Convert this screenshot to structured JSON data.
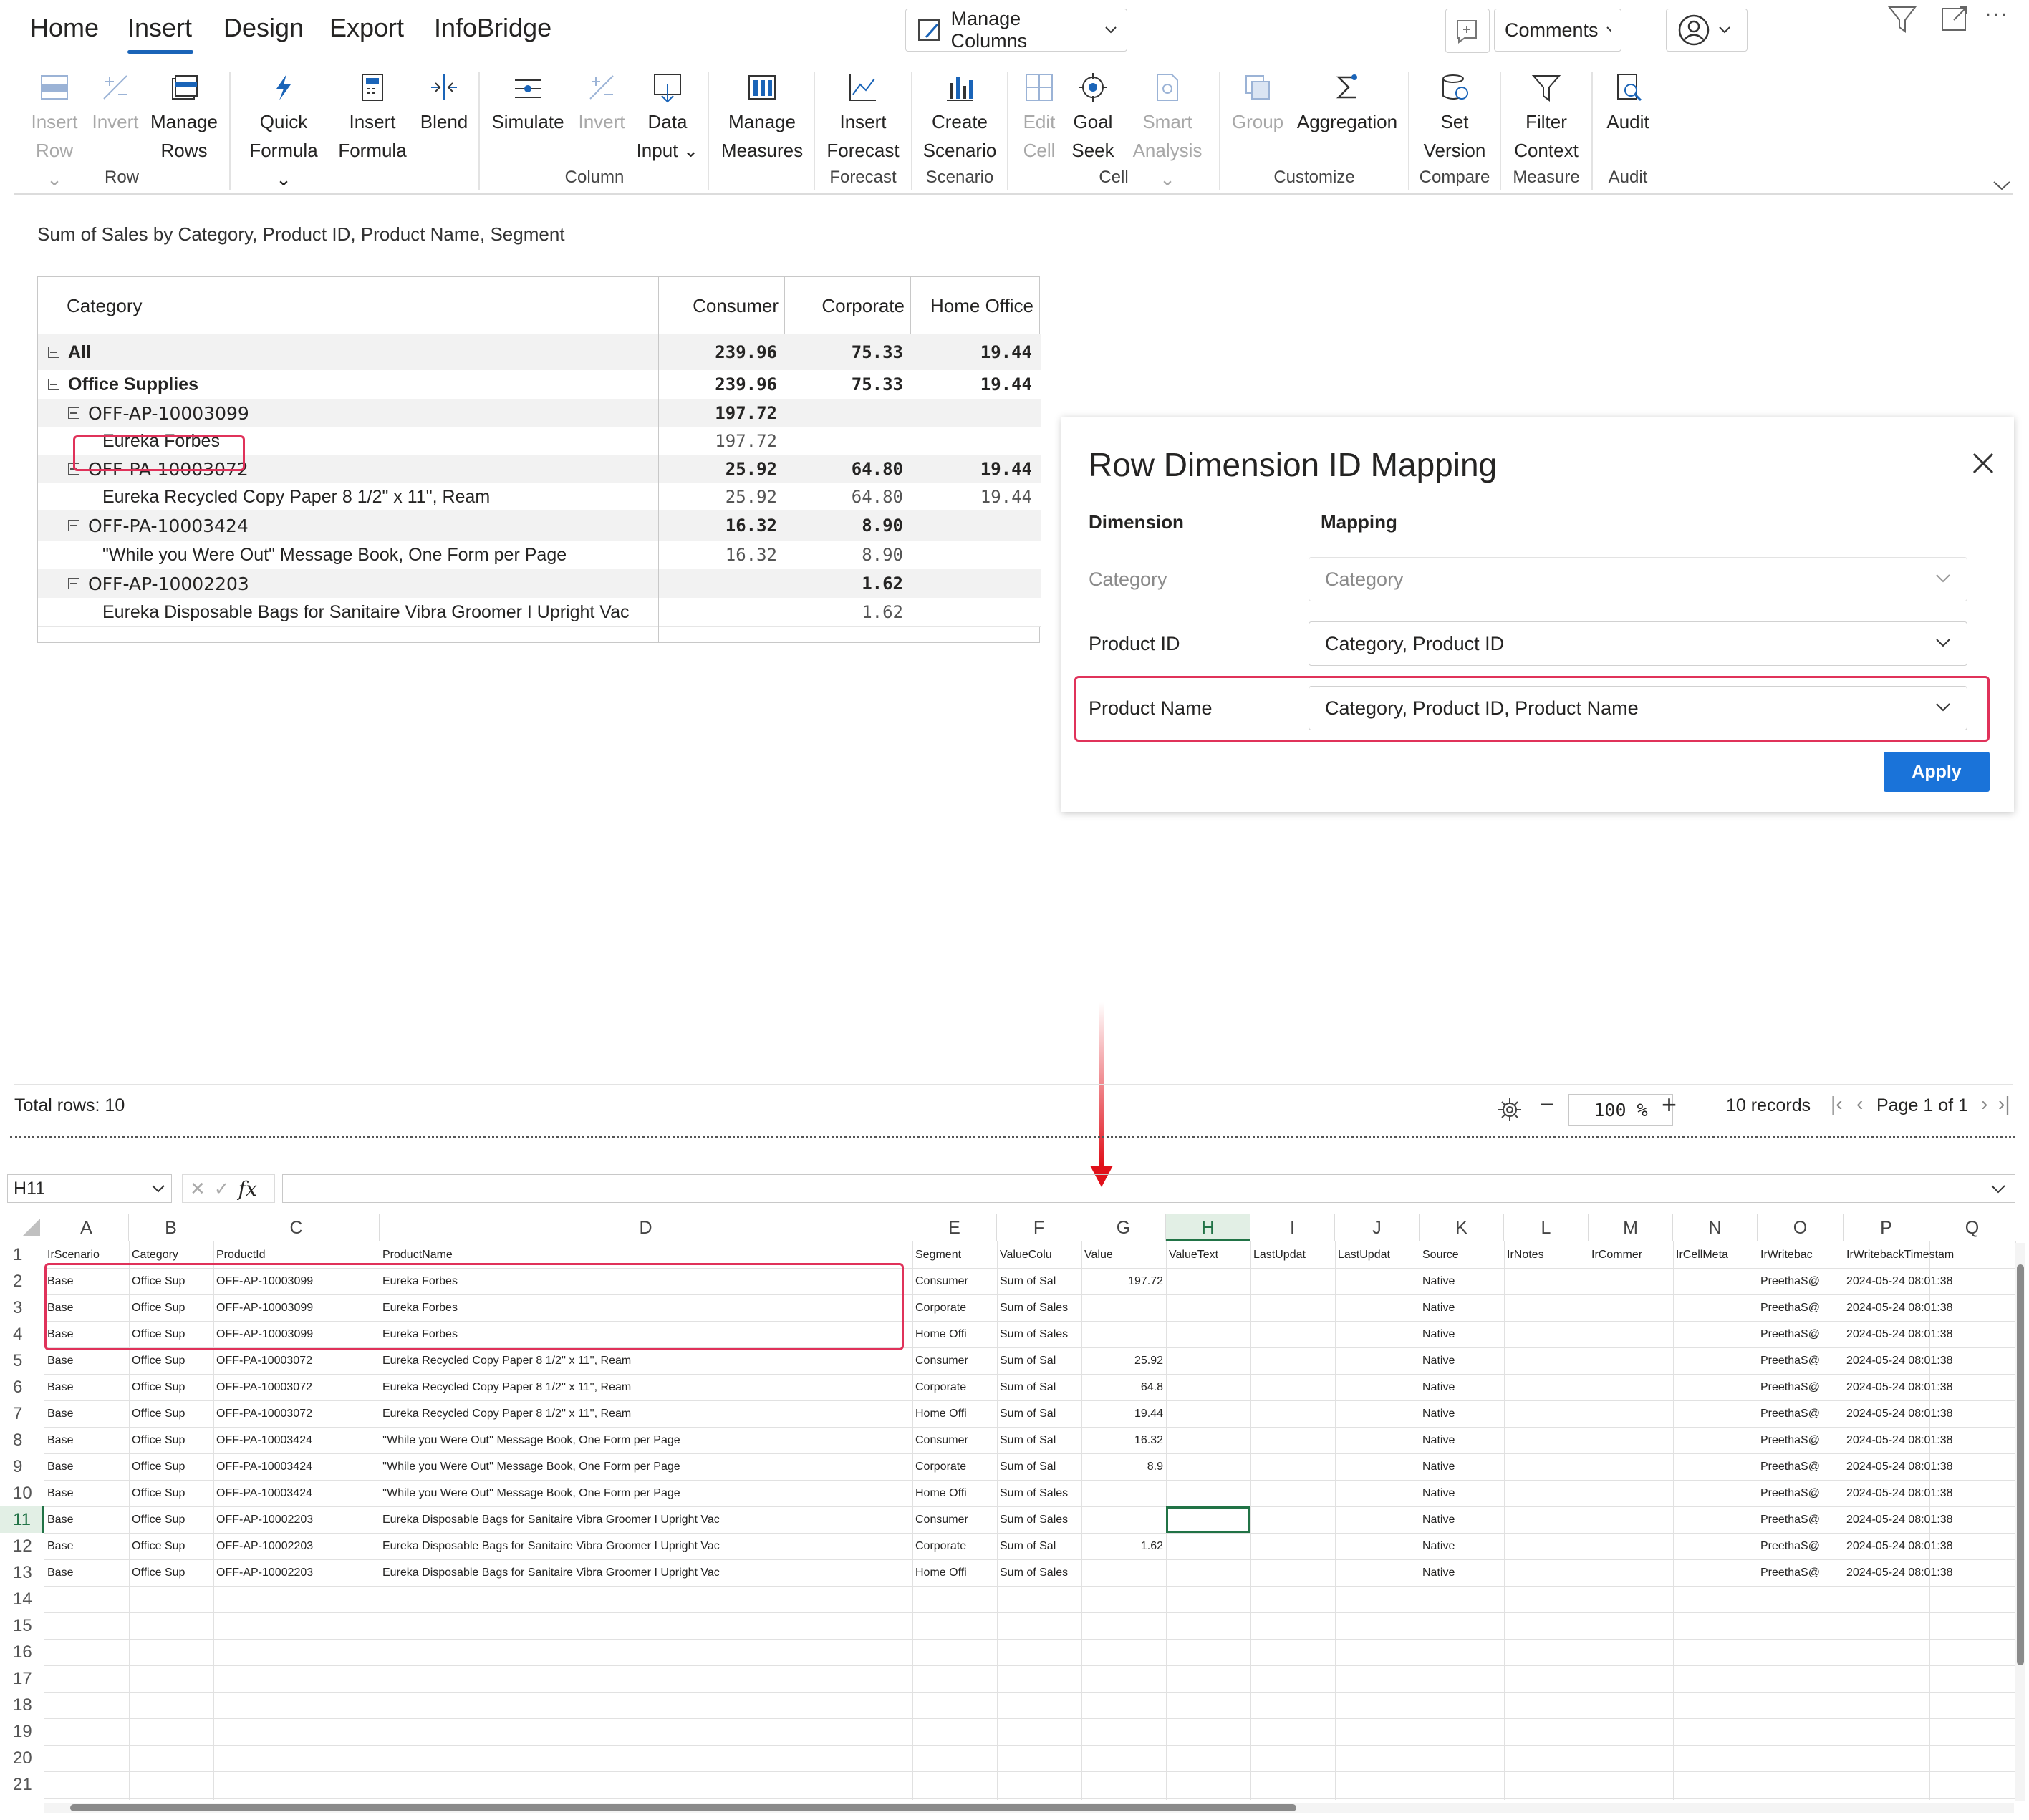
{
  "tabs": [
    "Home",
    "Insert",
    "Design",
    "Export",
    "InfoBridge"
  ],
  "active_tab": "Insert",
  "top_controls": {
    "manage_columns": "Manage Columns",
    "comments": "Comments"
  },
  "ribbon": {
    "buttons": [
      {
        "label1": "Insert",
        "label2": "Row",
        "dropdown": true,
        "disabled": true,
        "icon": "insert-row-icon"
      },
      {
        "label1": "Invert",
        "label2": "",
        "disabled": true,
        "icon": "invert-icon"
      },
      {
        "label1": "Manage",
        "label2": "Rows",
        "disabled": false,
        "icon": "manage-rows-icon"
      },
      {
        "label1": "Quick",
        "label2": "Formula",
        "dropdown": true,
        "disabled": false,
        "icon": "lightning-icon"
      },
      {
        "label1": "Insert",
        "label2": "Formula",
        "disabled": false,
        "icon": "calculator-icon"
      },
      {
        "label1": "Blend",
        "label2": "",
        "disabled": false,
        "icon": "blend-icon"
      },
      {
        "label1": "Simulate",
        "label2": "",
        "disabled": false,
        "icon": "simulate-icon"
      },
      {
        "label1": "Invert",
        "label2": "",
        "disabled": true,
        "icon": "invert-icon"
      },
      {
        "label1": "Data",
        "label2": "Input",
        "dropdown": true,
        "disabled": false,
        "icon": "data-input-icon"
      },
      {
        "label1": "Manage",
        "label2": "Measures",
        "disabled": false,
        "icon": "manage-measures-icon"
      },
      {
        "label1": "Insert",
        "label2": "Forecast",
        "disabled": false,
        "icon": "forecast-icon"
      },
      {
        "label1": "Create",
        "label2": "Scenario",
        "disabled": false,
        "icon": "scenario-icon"
      },
      {
        "label1": "Edit",
        "label2": "Cell",
        "disabled": true,
        "icon": "edit-cell-icon"
      },
      {
        "label1": "Goal",
        "label2": "Seek",
        "disabled": false,
        "icon": "goal-seek-icon"
      },
      {
        "label1": "Smart",
        "label2": "Analysis",
        "dropdown": true,
        "disabled": true,
        "icon": "smart-analysis-icon"
      },
      {
        "label1": "Group",
        "label2": "",
        "disabled": true,
        "icon": "group-icon"
      },
      {
        "label1": "Aggregation",
        "label2": "",
        "disabled": false,
        "icon": "sigma-icon"
      },
      {
        "label1": "Set",
        "label2": "Version",
        "disabled": false,
        "icon": "set-version-icon"
      },
      {
        "label1": "Filter",
        "label2": "Context",
        "disabled": false,
        "icon": "filter-icon"
      },
      {
        "label1": "Audit",
        "label2": "",
        "disabled": false,
        "icon": "audit-icon"
      }
    ],
    "groups": [
      "Row",
      "Column",
      "Forecast",
      "Scenario",
      "Cell",
      "Customize",
      "Compare",
      "Measure",
      "Audit"
    ]
  },
  "report": {
    "subtitle": "Sum of Sales by Category, Product ID, Product Name, Segment",
    "header": {
      "category": "Category",
      "c1": "Consumer",
      "c2": "Corporate",
      "c3": "Home Office"
    },
    "rows": [
      {
        "label": "All",
        "bold": true,
        "expander": true,
        "indent": 0,
        "v": [
          "239.96",
          "75.33",
          "19.44"
        ],
        "shade": true
      },
      {
        "label": "Office Supplies",
        "bold": true,
        "expander": true,
        "indent": 0,
        "v": [
          "239.96",
          "75.33",
          "19.44"
        ],
        "shade": false
      },
      {
        "label": "OFF-AP-10003099",
        "bold": false,
        "expander": true,
        "indent": 1,
        "v": [
          "197.72",
          "",
          ""
        ],
        "shade": true
      },
      {
        "label": "Eureka Forbes",
        "bold": false,
        "expander": false,
        "indent": 2,
        "v": [
          "197.72",
          "",
          ""
        ],
        "shade": false
      },
      {
        "label": "OFF-PA-10003072",
        "bold": false,
        "expander": true,
        "indent": 1,
        "v": [
          "25.92",
          "64.80",
          "19.44"
        ],
        "shade": true
      },
      {
        "label": "Eureka Recycled Copy Paper 8 1/2\" x 11\", Ream",
        "bold": false,
        "expander": false,
        "indent": 2,
        "v": [
          "25.92",
          "64.80",
          "19.44"
        ],
        "shade": false
      },
      {
        "label": "OFF-PA-10003424",
        "bold": false,
        "expander": true,
        "indent": 1,
        "v": [
          "16.32",
          "8.90",
          ""
        ],
        "shade": true
      },
      {
        "label": "\"While you Were Out\" Message Book, One Form per Page",
        "bold": false,
        "expander": false,
        "indent": 2,
        "v": [
          "16.32",
          "8.90",
          ""
        ],
        "shade": false
      },
      {
        "label": "OFF-AP-10002203",
        "bold": false,
        "expander": true,
        "indent": 1,
        "v": [
          "",
          "1.62",
          ""
        ],
        "shade": true
      },
      {
        "label": "Eureka Disposable Bags for Sanitaire Vibra Groomer I Upright Vac",
        "bold": false,
        "expander": false,
        "indent": 2,
        "v": [
          "",
          "1.62",
          ""
        ],
        "shade": false
      }
    ]
  },
  "dialog": {
    "title": "Row Dimension ID Mapping",
    "col_dimension": "Dimension",
    "col_mapping": "Mapping",
    "rows": [
      {
        "dimension": "Category",
        "mapping": "Category",
        "disabled": true
      },
      {
        "dimension": "Product ID",
        "mapping": "Category, Product ID",
        "disabled": false
      },
      {
        "dimension": "Product Name",
        "mapping": "Category, Product ID, Product Name",
        "disabled": false
      }
    ],
    "apply": "Apply"
  },
  "status": {
    "total_rows": "Total rows: 10",
    "zoom": "100 %",
    "records": "10 records",
    "page": "Page",
    "page_num": "1",
    "of": "of 1"
  },
  "excel": {
    "name_box": "H11",
    "formula_icon": "fx",
    "columns": [
      "A",
      "B",
      "C",
      "D",
      "E",
      "F",
      "G",
      "H",
      "I",
      "J",
      "K",
      "L",
      "M",
      "N",
      "O",
      "P",
      "Q"
    ],
    "selected_col": "H",
    "row_numbers": [
      "1",
      "2",
      "3",
      "4",
      "5",
      "6",
      "7",
      "8",
      "9",
      "10",
      "11",
      "12",
      "13",
      "14",
      "15",
      "16",
      "17",
      "18",
      "19",
      "20",
      "21"
    ],
    "header_row": [
      "IrScenario",
      "Category",
      "ProductId",
      "ProductName",
      "Segment",
      "ValueColu",
      "Value",
      "ValueText",
      "LastUpdat",
      "LastUpdat",
      "Source",
      "IrNotes",
      "IrCommer",
      "IrCellMeta",
      "IrWritebac",
      "IrWritebackTimestam",
      ""
    ],
    "data": [
      [
        "Base",
        "Office Sup",
        "OFF-AP-10003099",
        "Eureka Forbes",
        "Consumer",
        "Sum of Sal",
        "197.72",
        "",
        "",
        "",
        "Native",
        "",
        "",
        "",
        "PreethaS@",
        "2024-05-24 08:01:38"
      ],
      [
        "Base",
        "Office Sup",
        "OFF-AP-10003099",
        "Eureka Forbes",
        "Corporate",
        "Sum of Sales",
        "",
        "",
        "",
        "",
        "Native",
        "",
        "",
        "",
        "PreethaS@",
        "2024-05-24 08:01:38"
      ],
      [
        "Base",
        "Office Sup",
        "OFF-AP-10003099",
        "Eureka Forbes",
        "Home Offi",
        "Sum of Sales",
        "",
        "",
        "",
        "",
        "Native",
        "",
        "",
        "",
        "PreethaS@",
        "2024-05-24 08:01:38"
      ],
      [
        "Base",
        "Office Sup",
        "OFF-PA-10003072",
        "Eureka Recycled Copy Paper 8 1/2'' x 11'', Ream",
        "Consumer",
        "Sum of Sal",
        "25.92",
        "",
        "",
        "",
        "Native",
        "",
        "",
        "",
        "PreethaS@",
        "2024-05-24 08:01:38"
      ],
      [
        "Base",
        "Office Sup",
        "OFF-PA-10003072",
        "Eureka Recycled Copy Paper 8 1/2'' x 11'', Ream",
        "Corporate",
        "Sum of Sal",
        "64.8",
        "",
        "",
        "",
        "Native",
        "",
        "",
        "",
        "PreethaS@",
        "2024-05-24 08:01:38"
      ],
      [
        "Base",
        "Office Sup",
        "OFF-PA-10003072",
        "Eureka Recycled Copy Paper 8 1/2'' x 11'', Ream",
        "Home Offi",
        "Sum of Sal",
        "19.44",
        "",
        "",
        "",
        "Native",
        "",
        "",
        "",
        "PreethaS@",
        "2024-05-24 08:01:38"
      ],
      [
        "Base",
        "Office Sup",
        "OFF-PA-10003424",
        "''While you Were Out'' Message Book, One Form per Page",
        "Consumer",
        "Sum of Sal",
        "16.32",
        "",
        "",
        "",
        "Native",
        "",
        "",
        "",
        "PreethaS@",
        "2024-05-24 08:01:38"
      ],
      [
        "Base",
        "Office Sup",
        "OFF-PA-10003424",
        "''While you Were Out'' Message Book, One Form per Page",
        "Corporate",
        "Sum of Sal",
        "8.9",
        "",
        "",
        "",
        "Native",
        "",
        "",
        "",
        "PreethaS@",
        "2024-05-24 08:01:38"
      ],
      [
        "Base",
        "Office Sup",
        "OFF-PA-10003424",
        "''While you Were Out'' Message Book, One Form per Page",
        "Home Offi",
        "Sum of Sales",
        "",
        "",
        "",
        "",
        "Native",
        "",
        "",
        "",
        "PreethaS@",
        "2024-05-24 08:01:38"
      ],
      [
        "Base",
        "Office Sup",
        "OFF-AP-10002203",
        "Eureka Disposable Bags for Sanitaire Vibra Groomer I Upright Vac",
        "Consumer",
        "Sum of Sales",
        "",
        "",
        "",
        "",
        "Native",
        "",
        "",
        "",
        "PreethaS@",
        "2024-05-24 08:01:38"
      ],
      [
        "Base",
        "Office Sup",
        "OFF-AP-10002203",
        "Eureka Disposable Bags for Sanitaire Vibra Groomer I Upright Vac",
        "Corporate",
        "Sum of Sal",
        "1.62",
        "",
        "",
        "",
        "Native",
        "",
        "",
        "",
        "PreethaS@",
        "2024-05-24 08:01:38"
      ],
      [
        "Base",
        "Office Sup",
        "OFF-AP-10002203",
        "Eureka Disposable Bags for Sanitaire Vibra Groomer I Upright Vac",
        "Home Offi",
        "Sum of Sales",
        "",
        "",
        "",
        "",
        "Native",
        "",
        "",
        "",
        "PreethaS@",
        "2024-05-24 08:01:38"
      ]
    ]
  },
  "colors": {
    "accent": "#1a64b8",
    "highlight": "#e0325a",
    "apply_bg": "#1a73d9",
    "arrow": "#e0101a",
    "selected_cell": "#217346"
  }
}
